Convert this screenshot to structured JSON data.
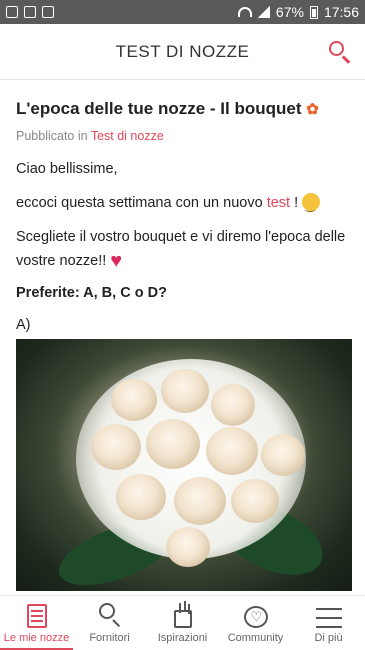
{
  "status_bar": {
    "battery": "67%",
    "time": "17:56"
  },
  "app_bar": {
    "title": "TEST DI NOZZE"
  },
  "post": {
    "title": "L'epoca delle tue nozze - Il bouquet",
    "meta_prefix": "Pubblicato in ",
    "category": "Test di nozze",
    "greeting": "Ciao bellissime,",
    "intro_before": "eccoci questa settimana con un nuovo ",
    "intro_link": "test",
    "intro_after": " !",
    "choose": "Scegliete il vostro bouquet e vi diremo l'epoca delle vostre nozze!!",
    "preferences": "Preferite: A, B, C o D?",
    "option_label": "A)"
  },
  "bottom_nav": {
    "items": [
      {
        "label": "Le mie nozze",
        "icon": "notebook-icon",
        "active": true
      },
      {
        "label": "Fornitori",
        "icon": "search-icon",
        "active": false
      },
      {
        "label": "Ispirazioni",
        "icon": "inspiration-icon",
        "active": false
      },
      {
        "label": "Community",
        "icon": "community-icon",
        "active": false
      },
      {
        "label": "Di più",
        "icon": "menu-icon",
        "active": false
      }
    ]
  },
  "colors": {
    "accent": "#e0475c",
    "status_bar": "#5a5a5a"
  }
}
